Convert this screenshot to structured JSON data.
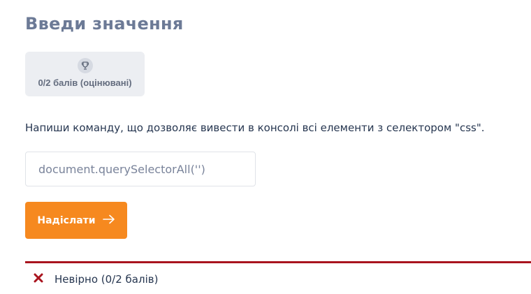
{
  "exercise": {
    "title": "Введи значення",
    "score_label": "0/2 балів (оцінювані)",
    "question": "Напиши команду, що дозволяє вивести в консолі всі елементи з селектором \"css\".",
    "answer_value": "document.querySelectorAll('')",
    "submit_label": "Надіслати"
  },
  "result": {
    "text": "Невірно (0/2 балів)"
  },
  "icons": {
    "score": "trophy-icon",
    "submit": "arrow-right-icon",
    "result": "cross-icon"
  },
  "colors": {
    "accent": "#f6891f",
    "error": "#a9141e",
    "title": "#6c7a96",
    "text": "#263650"
  }
}
